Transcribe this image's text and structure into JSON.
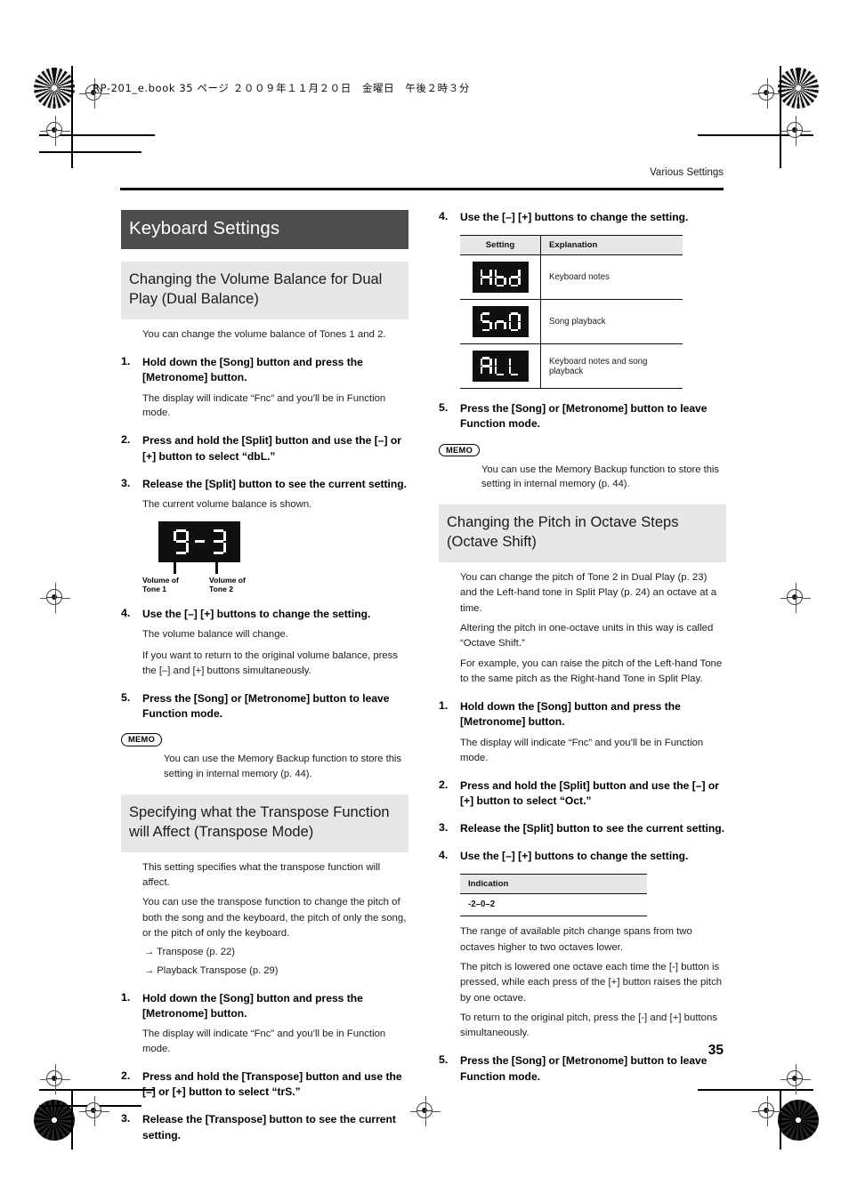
{
  "printer": {
    "book_line": "RP-201_e.book  35 ページ  ２００９年１１月２０日　金曜日　午後２時３分"
  },
  "page": {
    "running_head": "Various Settings",
    "page_number": "35",
    "chapter_title": "Keyboard Settings"
  },
  "left_column": {
    "section1": {
      "heading": "Changing the Volume Balance for Dual Play (Dual Balance)",
      "intro": "You can change the volume balance of Tones 1 and 2.",
      "steps": [
        {
          "num": "1.",
          "title": "Hold down the [Song] button and press the [Metronome] button.",
          "body": [
            "The display will indicate “Fnc” and you’ll be in Function mode."
          ]
        },
        {
          "num": "2.",
          "title": "Press and hold the [Split] button and use the [–] or [+] button to select “dbL.”",
          "body": []
        },
        {
          "num": "3.",
          "title": "Release the [Split] button to see the current setting.",
          "body": [
            "The current volume balance is shown."
          ]
        },
        {
          "num": "4.",
          "title": "Use the [–] [+] buttons to change the setting.",
          "body": [
            "The volume balance will change.",
            "If you want to return to the original volume balance, press the [–] and [+] buttons simultaneously."
          ]
        },
        {
          "num": "5.",
          "title": "Press the [Song] or [Metronome] button to leave Function mode.",
          "body": []
        }
      ],
      "display_figure": {
        "value": "9-3",
        "digits": [
          "9",
          "-",
          "3"
        ],
        "callout_left": "Volume of\nTone 1",
        "callout_left_line1": "Volume of",
        "callout_left_line2": "Tone 1",
        "callout_right_line1": "Volume of",
        "callout_right_line2": "Tone 2"
      },
      "memo": {
        "badge": "MEMO",
        "text": "You can use the Memory Backup function to store this setting in internal memory (p. 44)."
      }
    },
    "section2": {
      "heading": "Specifying what the Transpose Function will Affect (Transpose Mode)",
      "paragraphs": [
        "This setting specifies what the transpose function will affect.",
        "You can use the transpose function to change the pitch of both the song and the keyboard, the pitch of only the song, or the pitch of only the keyboard."
      ],
      "links": [
        "→ Transpose (p. 22)",
        "→ Playback Transpose (p. 29)"
      ],
      "steps": [
        {
          "num": "1.",
          "title": "Hold down the [Song] button and press the [Metronome] button.",
          "body": [
            "The display will indicate “Fnc” and you’ll be in Function mode."
          ]
        },
        {
          "num": "2.",
          "title": "Press and hold the [Transpose] button and use the [–] or [+] button to select “trS.”",
          "body": []
        },
        {
          "num": "3.",
          "title": "Release the [Transpose] button to see the current setting.",
          "body": []
        }
      ]
    }
  },
  "right_column": {
    "step4": {
      "num": "4.",
      "title": "Use the [–] [+] buttons to change the setting."
    },
    "settings_table": {
      "headers": [
        "Setting",
        "Explanation"
      ],
      "rows": [
        {
          "display": "Kbd",
          "digits": [
            "K",
            "b",
            "d"
          ],
          "explanation": "Keyboard notes"
        },
        {
          "display": "SnG",
          "digits": [
            "S",
            "n",
            "G"
          ],
          "explanation": "Song playback"
        },
        {
          "display": "ALL",
          "digits": [
            "A",
            "L",
            "L"
          ],
          "explanation": "Keyboard notes and song playback"
        }
      ]
    },
    "step5": {
      "num": "5.",
      "title": "Press the [Song] or [Metronome] button to leave Function mode."
    },
    "memo": {
      "badge": "MEMO",
      "text": "You can use the Memory Backup function to store this setting in internal memory (p. 44)."
    },
    "section3": {
      "heading": "Changing the Pitch in Octave Steps (Octave Shift)",
      "paragraphs": [
        "You can change the pitch of Tone 2 in Dual Play (p. 23) and the Left-hand tone in Split Play (p. 24) an octave at a time.",
        "Altering the pitch in one-octave units in this way is called “Octave Shift.”",
        "For example, you can raise the pitch of the Left-hand Tone to the same pitch as the Right-hand Tone in Split Play."
      ],
      "steps": [
        {
          "num": "1.",
          "title": "Hold down the [Song] button and press the [Metronome] button.",
          "body": [
            "The display will indicate “Fnc” and you’ll be in Function mode."
          ]
        },
        {
          "num": "2.",
          "title": "Press and hold the [Split] button and use the [–] or [+] button to select “Oct.”",
          "body": []
        },
        {
          "num": "3.",
          "title": "Release the [Split] button to see the current setting.",
          "body": []
        },
        {
          "num": "4.",
          "title": "Use the [–] [+] buttons to change the setting.",
          "body": []
        }
      ],
      "indication_table": {
        "header": "Indication",
        "value": "-2–0–2"
      },
      "after_table_paragraphs": [
        "The range of available pitch change spans from two octaves higher to two octaves lower.",
        "The pitch is lowered one octave each time the [-] button is pressed, while each press of the [+] button raises the pitch by one octave.",
        "To return to the original pitch, press the [-] and [+] buttons simultaneously."
      ],
      "final_step": {
        "num": "5.",
        "title": "Press the [Song] or [Metronome] button to leave Function mode."
      }
    }
  }
}
